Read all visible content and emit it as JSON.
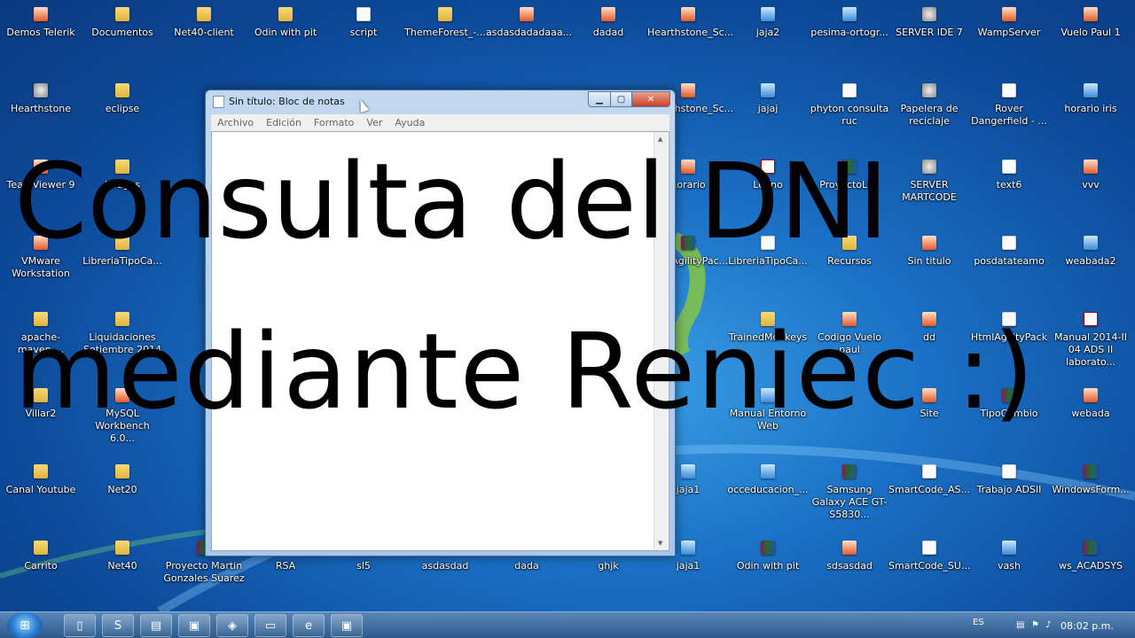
{
  "desktop": {
    "icons": [
      {
        "label": "Demos Telerik",
        "kind": "app",
        "icon": "web-icon"
      },
      {
        "label": "Documentos",
        "kind": "folder",
        "icon": "folder-icon"
      },
      {
        "label": "Net40-client",
        "kind": "folder",
        "icon": "folder-icon"
      },
      {
        "label": "Odin with pit",
        "kind": "folder",
        "icon": "folder-icon"
      },
      {
        "label": "script",
        "kind": "file",
        "icon": "script-icon"
      },
      {
        "label": "ThemeForest_-...",
        "kind": "folder",
        "icon": "folder-icon"
      },
      {
        "label": "asdasdadadaaa...",
        "kind": "app",
        "icon": "app-icon"
      },
      {
        "label": "dadad",
        "kind": "app",
        "icon": "app-icon"
      },
      {
        "label": "Hearthstone_Sc...",
        "kind": "app",
        "icon": "app-icon"
      },
      {
        "label": "jaja2",
        "kind": "web",
        "icon": "web-icon"
      },
      {
        "label": "pesima-ortogr...",
        "kind": "web",
        "icon": "web-icon"
      },
      {
        "label": "SERVER IDE 7",
        "kind": "gear",
        "icon": "server-icon"
      },
      {
        "label": "WampServer",
        "kind": "app",
        "icon": "wamp-icon"
      },
      {
        "label": "Vuelo Paul 1",
        "kind": "app",
        "icon": "app-icon"
      },
      {
        "label": "Hearthstone",
        "kind": "gear",
        "icon": "game-icon"
      },
      {
        "label": "eclipse",
        "kind": "folder",
        "icon": "folder-icon"
      },
      {
        "label": "Hearthstone_Sc...",
        "kind": "app",
        "icon": "app-icon"
      },
      {
        "label": "jajaj",
        "kind": "web",
        "icon": "web-icon"
      },
      {
        "label": "phyton consulta ruc",
        "kind": "file",
        "icon": "file-icon"
      },
      {
        "label": "Papelera de reciclaje",
        "kind": "gear",
        "icon": "recycle-bin-icon"
      },
      {
        "label": "Rover Dangerfield - ...",
        "kind": "file",
        "icon": "file-icon"
      },
      {
        "label": "horario iris",
        "kind": "web",
        "icon": "web-icon"
      },
      {
        "label": "TeamViewer 9",
        "kind": "app",
        "icon": "teamviewer-icon"
      },
      {
        "label": "Images",
        "kind": "folder",
        "icon": "folder-icon"
      },
      {
        "label": "horario",
        "kind": "app",
        "icon": "app-icon"
      },
      {
        "label": "Lenno",
        "kind": "pdf",
        "icon": "file-icon"
      },
      {
        "label": "ProyectoLP1",
        "kind": "rar",
        "icon": "archive-icon"
      },
      {
        "label": "SERVER MARTCODE",
        "kind": "gear",
        "icon": "server-icon"
      },
      {
        "label": "text6",
        "kind": "file",
        "icon": "file-icon"
      },
      {
        "label": "vvv",
        "kind": "app",
        "icon": "app-icon"
      },
      {
        "label": "VMware Workstation",
        "kind": "app",
        "icon": "vmware-icon"
      },
      {
        "label": "LibreriaTipoCa...",
        "kind": "folder",
        "icon": "folder-icon"
      },
      {
        "label": "HtmlAgilityPac...",
        "kind": "rar",
        "icon": "archive-icon"
      },
      {
        "label": "LibreriaTipoCa...",
        "kind": "file",
        "icon": "file-icon"
      },
      {
        "label": "Recursos",
        "kind": "folder",
        "icon": "folder-icon"
      },
      {
        "label": "Sin titulo",
        "kind": "app",
        "icon": "app-icon"
      },
      {
        "label": "posdatateamo",
        "kind": "file",
        "icon": "file-icon"
      },
      {
        "label": "weabada2",
        "kind": "web",
        "icon": "web-icon"
      },
      {
        "label": "apache-maven-...",
        "kind": "folder",
        "icon": "folder-icon"
      },
      {
        "label": "Liquidaciones Setiembre 2014",
        "kind": "folder",
        "icon": "folder-icon"
      },
      {
        "label": "TrainedMonkeys",
        "kind": "folder",
        "icon": "folder-icon"
      },
      {
        "label": "Codigo Vuelo paul",
        "kind": "app",
        "icon": "app-icon"
      },
      {
        "label": "dd",
        "kind": "app",
        "icon": "app-icon"
      },
      {
        "label": "HtmlAgilityPack",
        "kind": "file",
        "icon": "file-icon"
      },
      {
        "label": "Manual 2014-II 04 ADS II laborato...",
        "kind": "pdf",
        "icon": "pdf-icon"
      },
      {
        "label": "Villar2",
        "kind": "folder",
        "icon": "folder-icon"
      },
      {
        "label": "MySQL Workbench 6.0...",
        "kind": "app",
        "icon": "mysql-icon"
      },
      {
        "label": "Manual Entorno Web",
        "kind": "web",
        "icon": "web-icon"
      },
      {
        "label": "Site",
        "kind": "app",
        "icon": "app-icon"
      },
      {
        "label": "TipoCambio",
        "kind": "rar",
        "icon": "archive-icon"
      },
      {
        "label": "webada",
        "kind": "app",
        "icon": "app-icon"
      },
      {
        "label": "Canal Youtube",
        "kind": "folder",
        "icon": "folder-icon"
      },
      {
        "label": "Net20",
        "kind": "folder",
        "icon": "folder-icon"
      },
      {
        "label": "jaja1",
        "kind": "web",
        "icon": "web-icon"
      },
      {
        "label": "occeducacion_...",
        "kind": "web",
        "icon": "web-icon"
      },
      {
        "label": "Samsung Galaxy ACE GT-S5830...",
        "kind": "rar",
        "icon": "archive-icon"
      },
      {
        "label": "SmartCode_AS...",
        "kind": "file",
        "icon": "file-icon"
      },
      {
        "label": "Trabajo ADSII",
        "kind": "file",
        "icon": "excel-icon"
      },
      {
        "label": "WindowsForm...",
        "kind": "rar",
        "icon": "archive-icon"
      },
      {
        "label": "Carrito",
        "kind": "folder",
        "icon": "folder-icon"
      },
      {
        "label": "Net40",
        "kind": "folder",
        "icon": "folder-icon"
      },
      {
        "label": "Proyecto Martin Gonzales Suarez",
        "kind": "rar",
        "icon": "archive-icon"
      },
      {
        "label": "RSA",
        "kind": "folder",
        "icon": "folder-icon"
      },
      {
        "label": "sl5",
        "kind": "folder",
        "icon": "folder-icon"
      },
      {
        "label": "asdasdad",
        "kind": "folder",
        "icon": "folder-icon"
      },
      {
        "label": "dada",
        "kind": "folder",
        "icon": "folder-icon"
      },
      {
        "label": "ghjk",
        "kind": "folder",
        "icon": "folder-icon"
      },
      {
        "label": "jaja1",
        "kind": "web",
        "icon": "web-icon"
      },
      {
        "label": "Odin with pit",
        "kind": "rar",
        "icon": "archive-icon"
      },
      {
        "label": "sdsasdad",
        "kind": "app",
        "icon": "app-icon"
      },
      {
        "label": "SmartCode_SU...",
        "kind": "file",
        "icon": "file-icon"
      },
      {
        "label": "vash",
        "kind": "web",
        "icon": "web-icon"
      },
      {
        "label": "ws_ACADSYS",
        "kind": "rar",
        "icon": "archive-icon"
      }
    ]
  },
  "notepad": {
    "title": "Sin título: Bloc de notas",
    "menu": [
      "Archivo",
      "Edición",
      "Formato",
      "Ver",
      "Ayuda"
    ],
    "content": ""
  },
  "caption": {
    "line1": "Consulta del DNI",
    "line2": "mediante Reniec :)"
  },
  "taskbar": {
    "buttons": [
      {
        "icon": "explorer-icon",
        "glyph": "▯"
      },
      {
        "icon": "skype-icon",
        "glyph": "S"
      },
      {
        "icon": "notepad-icon",
        "glyph": "▤"
      },
      {
        "icon": "camtasia-icon",
        "glyph": "▣"
      },
      {
        "icon": "visual-studio-icon",
        "glyph": "◈"
      },
      {
        "icon": "window-icon",
        "glyph": "▭"
      },
      {
        "icon": "internet-explorer-icon",
        "glyph": "e"
      },
      {
        "icon": "camtasia-recorder-icon",
        "glyph": "▣"
      }
    ],
    "language": "ES",
    "clock": "08:02 p.m."
  }
}
